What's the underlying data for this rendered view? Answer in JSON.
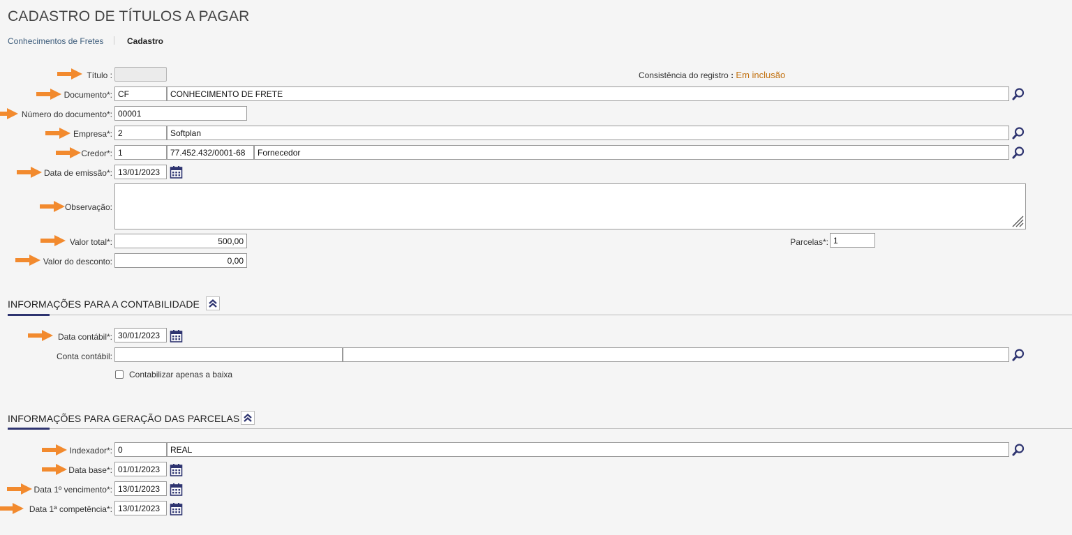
{
  "page": {
    "title": "CADASTRO DE TÍTULOS A PAGAR",
    "breadcrumb": {
      "link": "Conhecimentos de Fretes",
      "current": "Cadastro"
    }
  },
  "status": {
    "label": "Consistência do registro",
    "separator": ":",
    "value": "Em inclusão"
  },
  "form": {
    "titulo": {
      "label": "Título :",
      "value": ""
    },
    "documento": {
      "label": "Documento*:",
      "code": "CF",
      "description": "CONHECIMENTO DE FRETE"
    },
    "numero_documento": {
      "label": "Número do documento*:",
      "value": "00001"
    },
    "empresa": {
      "label": "Empresa*:",
      "code": "2",
      "description": "Softplan"
    },
    "credor": {
      "label": "Credor*:",
      "code": "1",
      "cnpj": "77.452.432/0001-68",
      "description": "Fornecedor"
    },
    "data_emissao": {
      "label": "Data de emissão*:",
      "value": "13/01/2023"
    },
    "observacao": {
      "label": "Observação:",
      "value": ""
    },
    "valor_total": {
      "label": "Valor total*:",
      "value": "500,00"
    },
    "parcelas": {
      "label": "Parcelas*:",
      "value": "1"
    },
    "valor_desconto": {
      "label": "Valor do desconto:",
      "value": "0,00"
    }
  },
  "contabilidade": {
    "title": "INFORMAÇÕES PARA A CONTABILIDADE",
    "data_contabil": {
      "label": "Data contábil*:",
      "value": "30/01/2023"
    },
    "conta_contabil": {
      "label": "Conta contábil:",
      "code": "",
      "description": ""
    },
    "checkbox": {
      "label": "Contabilizar apenas a baixa",
      "checked": false
    }
  },
  "parcelas_section": {
    "title": "INFORMAÇÕES PARA GERAÇÃO DAS PARCELAS",
    "indexador": {
      "label": "Indexador*:",
      "code": "0",
      "description": "REAL"
    },
    "data_base": {
      "label": "Data base*:",
      "value": "01/01/2023"
    },
    "data_vencimento": {
      "label": "Data 1º vencimento*:",
      "value": "13/01/2023"
    },
    "data_competencia": {
      "label": "Data 1ª competência*:",
      "value": "13/01/2023"
    }
  },
  "colors": {
    "accent": "#2e3470",
    "arrow": "#f28a2e",
    "status": "#c27212",
    "link": "#3b5b7a"
  },
  "icons": [
    "search-icon",
    "calendar-icon",
    "collapse-icon",
    "arrow-indicator-icon",
    "resize-handle-icon"
  ]
}
